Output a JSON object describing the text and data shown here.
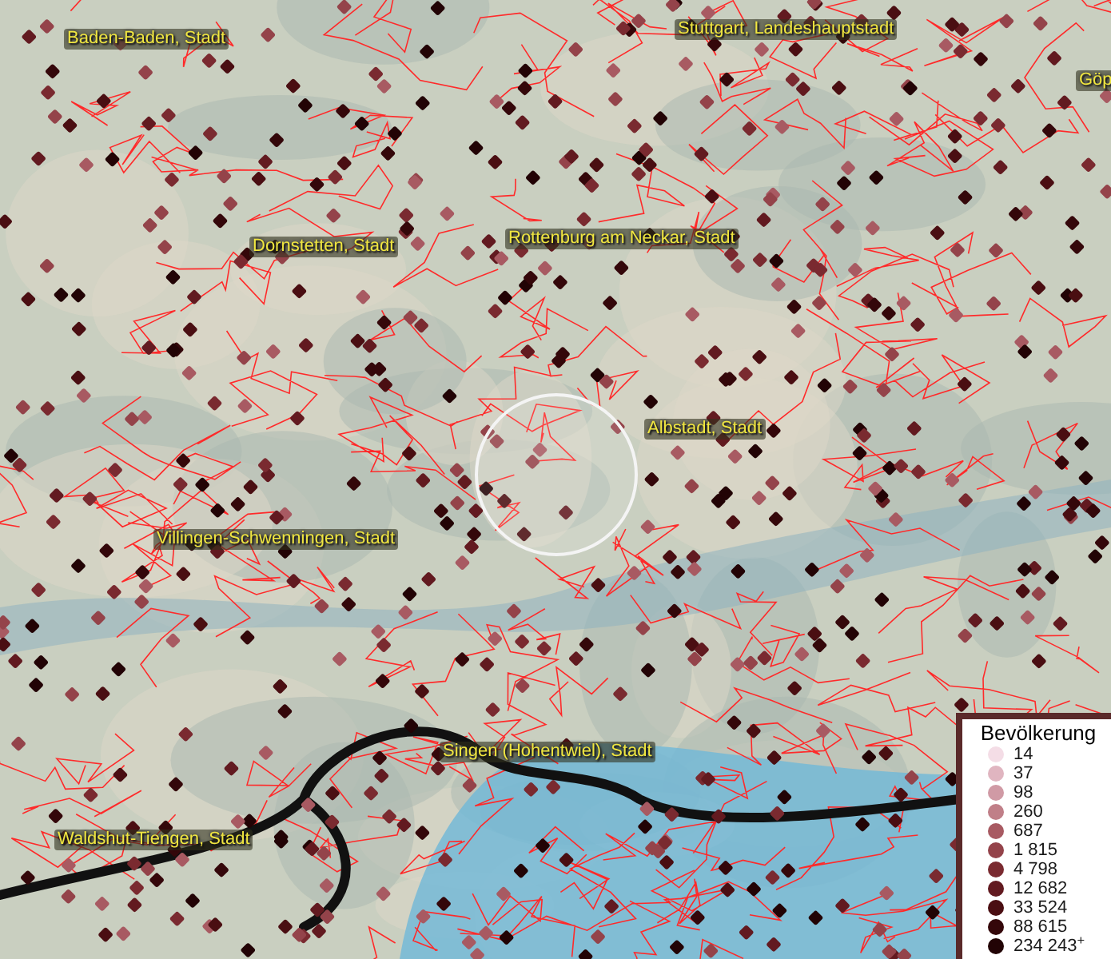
{
  "map": {
    "place_labels": [
      {
        "text": "Baden-Baden, Stadt"
      },
      {
        "text": "Stuttgart, Landeshauptstadt"
      },
      {
        "text": "Göp"
      },
      {
        "text": "Dornstetten, Stadt"
      },
      {
        "text": "Rottenburg am Neckar, Stadt"
      },
      {
        "text": "Albstadt, Stadt"
      },
      {
        "text": "Villingen-Schwenningen, Stadt"
      },
      {
        "text": "Singen (Hohentwiel), Stadt"
      },
      {
        "text": "Waldshut-Tiengen, Stadt"
      }
    ]
  },
  "legend": {
    "title": "Bevölkerung",
    "entries": [
      {
        "value": "14",
        "color": "#f4dde6"
      },
      {
        "value": "37",
        "color": "#e0b5c0"
      },
      {
        "value": "98",
        "color": "#d09aa5"
      },
      {
        "value": "260",
        "color": "#c07f88"
      },
      {
        "value": "687",
        "color": "#a85a62"
      },
      {
        "value": "1 815",
        "color": "#94434a"
      },
      {
        "value": "4 798",
        "color": "#7a2a30"
      },
      {
        "value": "12 682",
        "color": "#621a20"
      },
      {
        "value": "33 524",
        "color": "#4a0e12"
      },
      {
        "value": "88 615",
        "color": "#34070a"
      },
      {
        "value": "234 243$^{+}$",
        "color": "#220305"
      }
    ]
  }
}
